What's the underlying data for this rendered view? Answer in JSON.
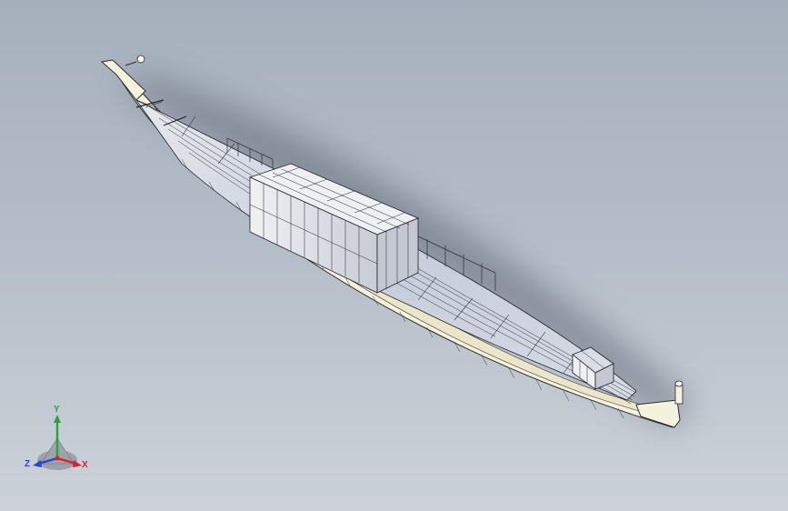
{
  "viewport": {
    "background_top": "#a6b0bd",
    "background_bottom": "#cdd2d9"
  },
  "model": {
    "hull_color": "#f4f1dc",
    "wire_color": "#1f2328",
    "cabin_panel_color": "#dfe2ea",
    "deck_color": "#c9cfdc"
  },
  "triad": {
    "x_label": "X",
    "y_label": "Y",
    "z_label": "Z",
    "x_color": "#d8232a",
    "y_color": "#22a83a",
    "z_color": "#2844d8"
  }
}
